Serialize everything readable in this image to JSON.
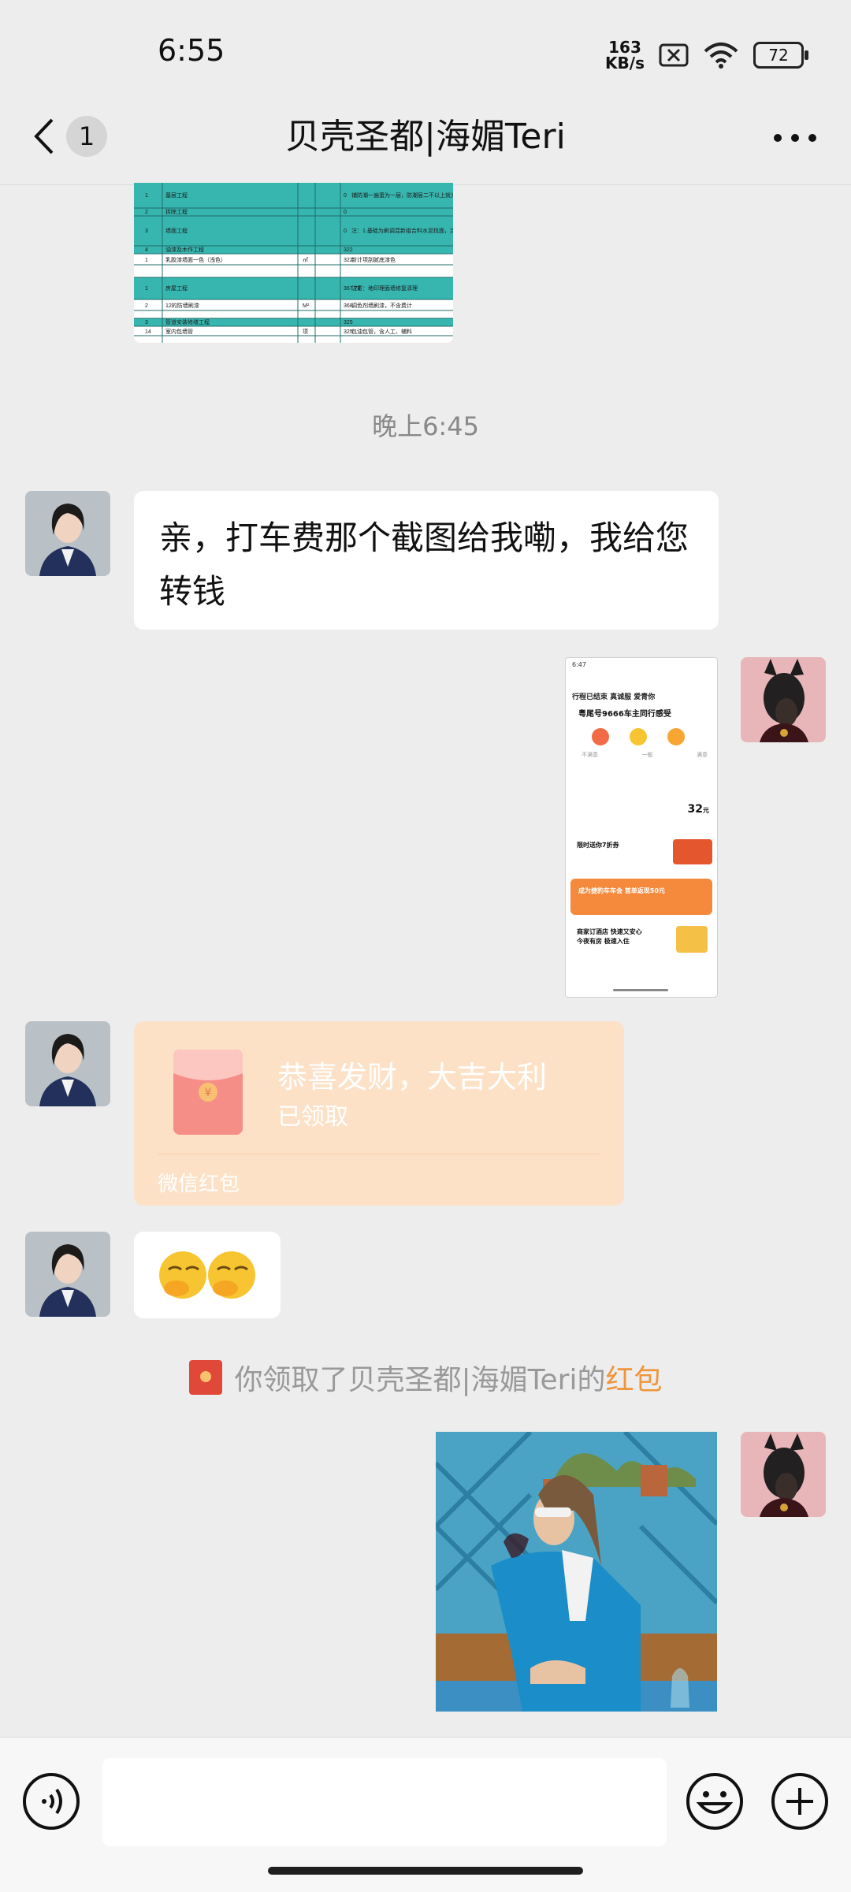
{
  "status_bar": {
    "time": "6:55",
    "net_speed_top": "163",
    "net_speed_bottom": "KB/s",
    "battery": "72"
  },
  "header": {
    "unread_count": "1",
    "title": "贝壳圣都|海媚Teri"
  },
  "spreadsheet": {
    "rows": [
      [
        "1",
        "基层工程",
        "",
        "",
        "0",
        "铺防潮一遍蛋为一层，防潮层二不以上就为二层，捆扎、固合清理不分项目。"
      ],
      [
        "2",
        "拆除工程",
        "",
        "",
        "0",
        ""
      ],
      [
        "3",
        "墙面工程",
        "",
        "",
        "0",
        "注：1.基础为刷调混新组合料水泥找面，涂面宅满足标准，如需减免需要增加计"
      ],
      [
        "4",
        "油漆及木作工程",
        "",
        "",
        "322",
        ""
      ],
      [
        "1",
        "乳胶漆墙面一色（浅色）",
        "㎡",
        "",
        "322",
        "新计项刮腻底漆色"
      ],
      [
        "1",
        "房屋工程",
        "",
        "",
        "367.78",
        "注意：地印理面墙修复清理"
      ],
      [
        "2",
        "12的防墙刷漆",
        "M²",
        "",
        "368",
        "调色剂墙刷漆，不含费计"
      ],
      [
        "3",
        "管道安装修缮工程",
        "",
        "",
        "325",
        ""
      ],
      [
        "14",
        "室内包墙管",
        "项",
        "",
        "325",
        "包油包管，含人工、辅料"
      ]
    ]
  },
  "timestamp": "晚上6:45",
  "messages": {
    "text_1": "亲，打车费那个截图给我嘞，我给您转钱",
    "emoji_1": "🤭🤭",
    "photo_alt": "饮酒的男子"
  },
  "ride_screenshot": {
    "status_time": "6:47",
    "banner": "行程已结束 真诚服 爱青你",
    "driver": "粤尾号9666车主同行感受",
    "rating_labels": [
      "不满意",
      "一般",
      "满意"
    ],
    "fee_amount": "32",
    "fee_unit": "元",
    "promo_1": "限时送你7折券",
    "promo_2": "成为捷豹车车会 首单返现50元",
    "promo_3": "商家订酒店 快速又安心",
    "promo_3_sub": "今夜有房 极速入住"
  },
  "red_packet": {
    "title": "恭喜发财，大吉大利",
    "status": "已领取",
    "footer": "微信红包"
  },
  "system_notice": {
    "text": "你领取了贝壳圣都|海媚Teri的",
    "link": "红包"
  },
  "colors": {
    "background": "#ededed",
    "red_packet": "#fde1c7",
    "notice_link": "#f0953a"
  },
  "icons": [
    "back-icon",
    "more-icon",
    "voice-icon",
    "emoji-icon",
    "plus-icon",
    "red-packet-icon"
  ]
}
